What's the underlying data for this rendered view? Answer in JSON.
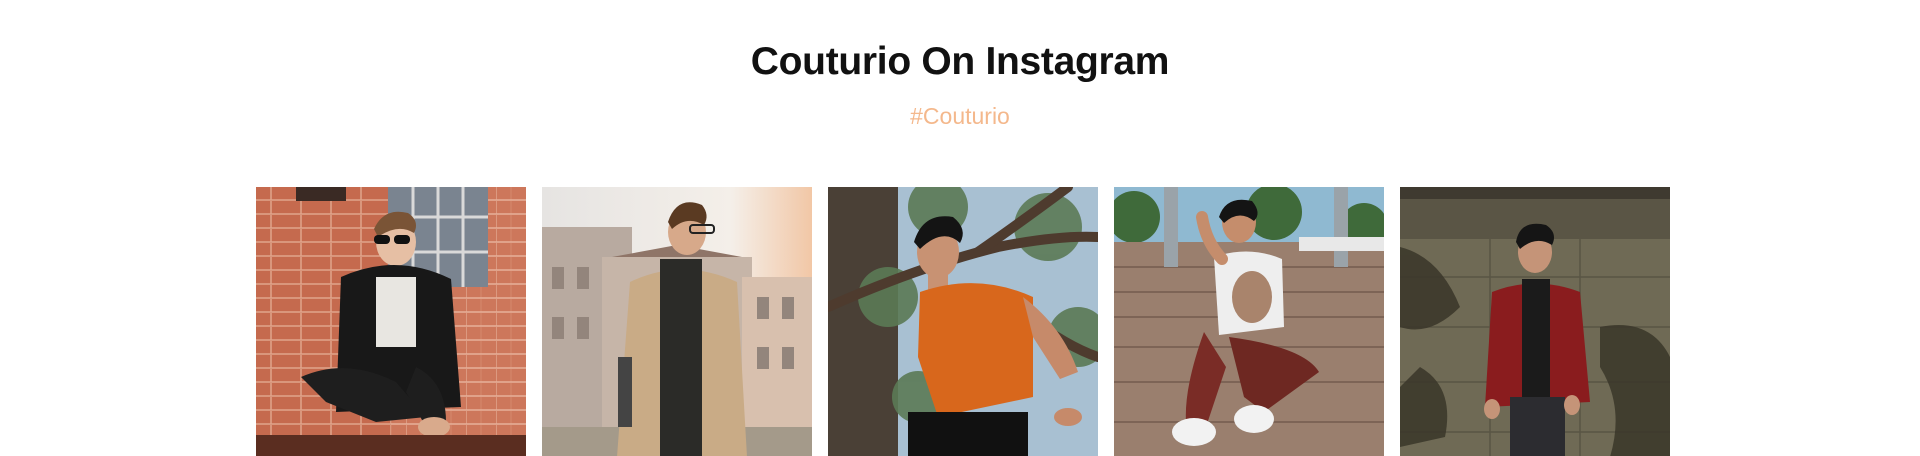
{
  "section": {
    "title": "Couturio On Instagram",
    "hashtag": "#Couturio"
  },
  "gallery": {
    "items": [
      {
        "description": "man in black leather jacket and sunglasses crouching in front of brick wall"
      },
      {
        "description": "man in camel coat with glasses in front of old building"
      },
      {
        "description": "man in orange t-shirt under tree branches"
      },
      {
        "description": "man in white printed t-shirt sitting on wooden deck"
      },
      {
        "description": "man in red jacket leaning against wall with shadows"
      }
    ]
  },
  "colors": {
    "title": "#111111",
    "accent": "#f4b88c"
  }
}
